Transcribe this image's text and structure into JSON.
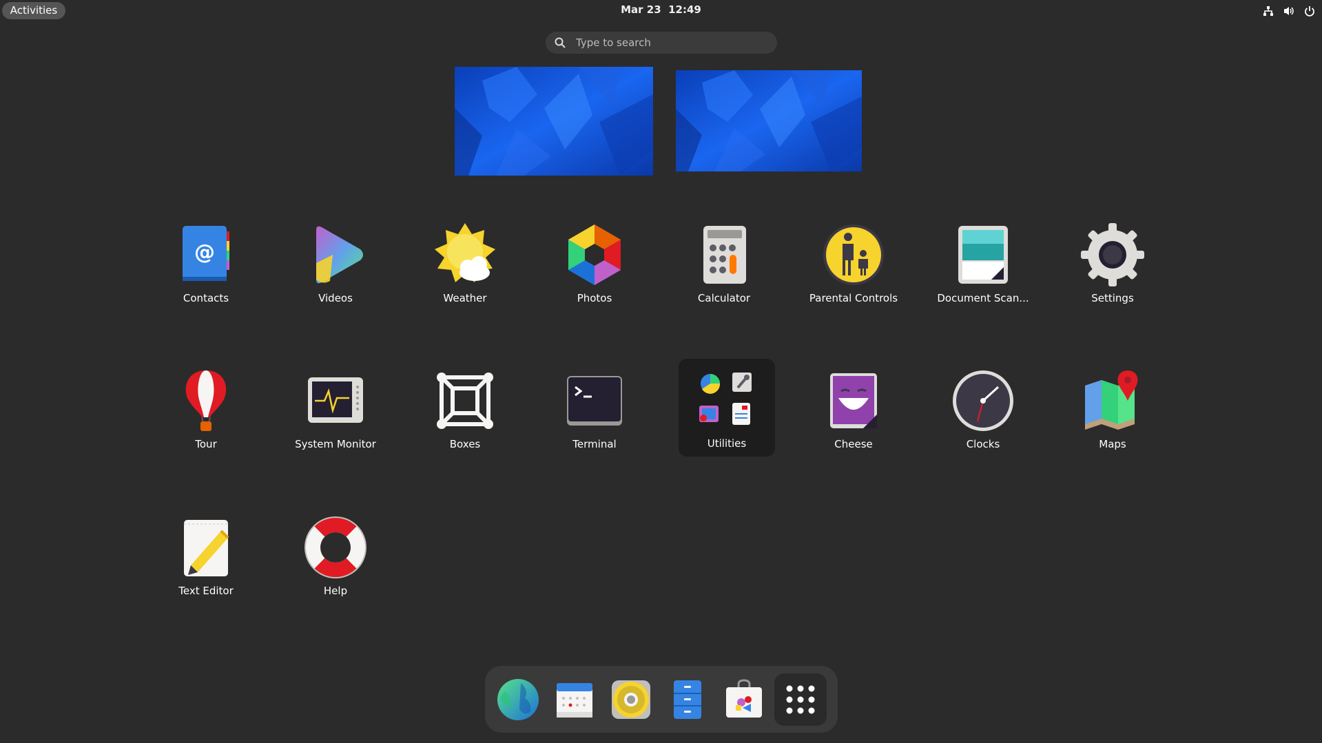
{
  "topbar": {
    "activities_label": "Activities",
    "date": "Mar 23",
    "time": "12:49",
    "system_icons": [
      "network-icon",
      "volume-icon",
      "power-icon"
    ]
  },
  "search": {
    "placeholder": "Type to search"
  },
  "workspaces": [
    {
      "name": "workspace-1"
    },
    {
      "name": "workspace-2"
    }
  ],
  "apps": [
    {
      "label": "Contacts",
      "icon": "contacts-icon"
    },
    {
      "label": "Videos",
      "icon": "videos-icon"
    },
    {
      "label": "Weather",
      "icon": "weather-icon"
    },
    {
      "label": "Photos",
      "icon": "photos-icon"
    },
    {
      "label": "Calculator",
      "icon": "calculator-icon"
    },
    {
      "label": "Parental Controls",
      "icon": "parental-controls-icon"
    },
    {
      "label": "Document Scan...",
      "icon": "document-scanner-icon"
    },
    {
      "label": "Settings",
      "icon": "settings-gear-icon"
    },
    {
      "label": "Tour",
      "icon": "tour-balloon-icon"
    },
    {
      "label": "System Monitor",
      "icon": "system-monitor-icon"
    },
    {
      "label": "Boxes",
      "icon": "boxes-icon"
    },
    {
      "label": "Terminal",
      "icon": "terminal-icon"
    },
    {
      "label": "Utilities",
      "icon": "utilities-folder-icon"
    },
    {
      "label": "Cheese",
      "icon": "cheese-icon"
    },
    {
      "label": "Clocks",
      "icon": "clocks-icon"
    },
    {
      "label": "Maps",
      "icon": "maps-icon"
    },
    {
      "label": "Text Editor",
      "icon": "text-editor-icon"
    },
    {
      "label": "Help",
      "icon": "help-lifebuoy-icon"
    }
  ],
  "dock": [
    {
      "icon": "web-browser-icon"
    },
    {
      "icon": "calendar-icon"
    },
    {
      "icon": "music-speaker-icon"
    },
    {
      "icon": "files-cabinet-icon"
    },
    {
      "icon": "software-store-icon"
    },
    {
      "icon": "show-apps-grid-icon"
    }
  ],
  "colors": {
    "background": "#2b2b2b",
    "folder_highlight": "#1d1d1d",
    "dock": "#3a3a3a",
    "accent_blue": "#3584e4"
  }
}
